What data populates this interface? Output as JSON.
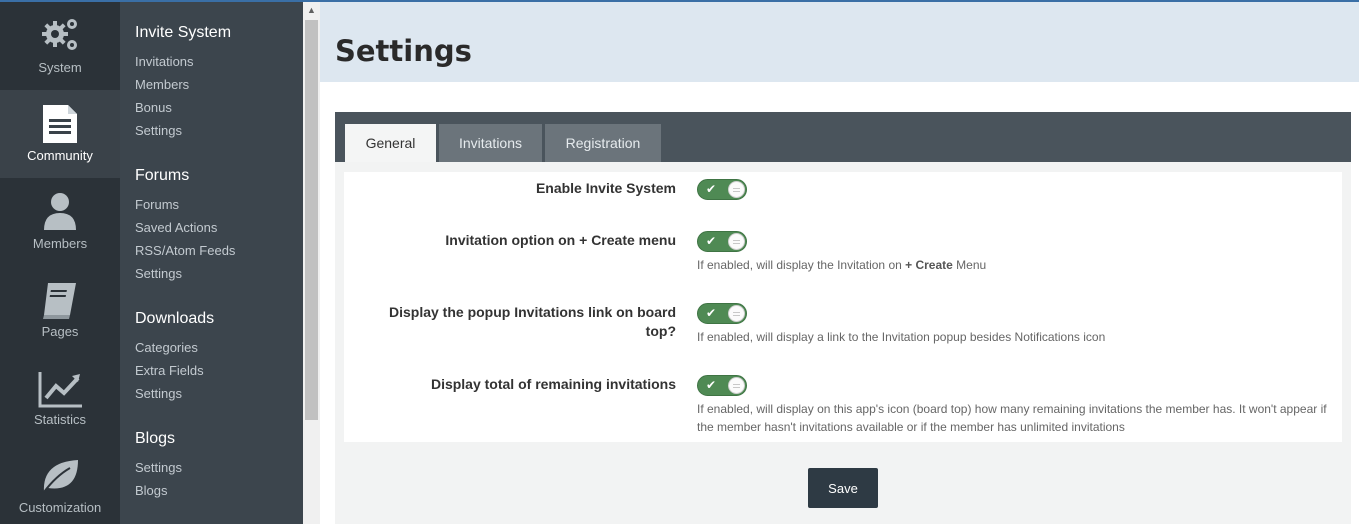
{
  "primary_nav": [
    {
      "label": "System",
      "icon": "gears-icon"
    },
    {
      "label": "Community",
      "icon": "document-icon"
    },
    {
      "label": "Members",
      "icon": "user-icon"
    },
    {
      "label": "Pages",
      "icon": "book-icon"
    },
    {
      "label": "Statistics",
      "icon": "chart-icon"
    },
    {
      "label": "Customization",
      "icon": "leaf-icon"
    }
  ],
  "secondary_nav": [
    {
      "title": "Invite System",
      "links": [
        "Invitations",
        "Members",
        "Bonus",
        "Settings"
      ]
    },
    {
      "title": "Forums",
      "links": [
        "Forums",
        "Saved Actions",
        "RSS/Atom Feeds",
        "Settings"
      ]
    },
    {
      "title": "Downloads",
      "links": [
        "Categories",
        "Extra Fields",
        "Settings"
      ]
    },
    {
      "title": "Blogs",
      "links": [
        "Settings",
        "Blogs"
      ]
    }
  ],
  "page": {
    "title": "Settings"
  },
  "tabs": [
    {
      "label": "General"
    },
    {
      "label": "Invitations"
    },
    {
      "label": "Registration"
    }
  ],
  "settings": [
    {
      "label": "Enable Invite System",
      "enabled": true,
      "desc_prefix": "",
      "desc_bold": "",
      "desc_suffix": ""
    },
    {
      "label": "Invitation option on + Create menu",
      "enabled": true,
      "desc_prefix": "If enabled, will display the Invitation on ",
      "desc_bold": "+ Create",
      "desc_suffix": " Menu"
    },
    {
      "label": "Display the popup Invitations link on board top?",
      "enabled": true,
      "desc_prefix": "If enabled, will display a link to the Invitation popup besides Notifications icon",
      "desc_bold": "",
      "desc_suffix": ""
    },
    {
      "label": "Display total of remaining invitations",
      "enabled": true,
      "desc_prefix": "If enabled, will display on this app's icon (board top) how many remaining invitations the member has. It won't appear if the member hasn't invitations available or if the member has unlimited invitations",
      "desc_bold": "",
      "desc_suffix": ""
    }
  ],
  "save_label": "Save",
  "colors": {
    "toggle_on": "#4f8a54",
    "sidebar": "#2b3238",
    "header_bg": "#dde7f0"
  }
}
